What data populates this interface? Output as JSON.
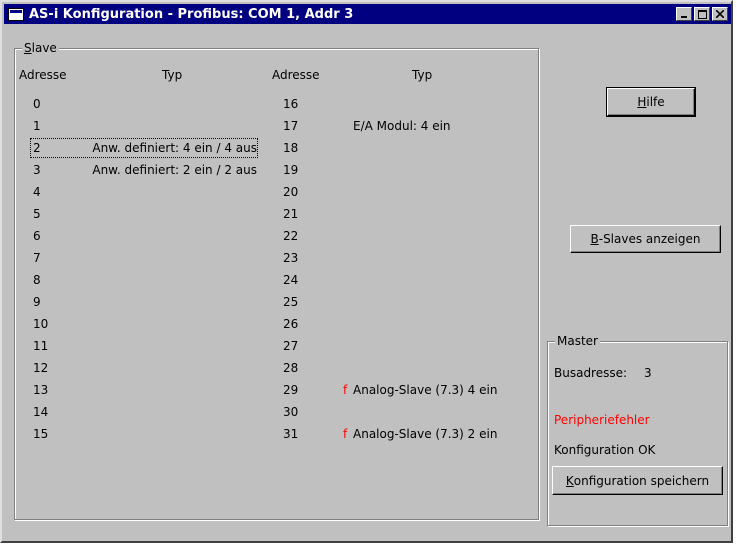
{
  "window": {
    "title": "AS-i Konfiguration - Profibus: COM 1, Addr 3",
    "icon": "window-app-icon",
    "controls": [
      "minimize",
      "maximize",
      "close"
    ]
  },
  "slave_group": {
    "label": "Slave",
    "label_accel": "S",
    "label_rest": "lave",
    "headers": {
      "adresse_left": "Adresse",
      "typ_left": "Typ",
      "adresse_right": "Adresse",
      "typ_right": "Typ"
    },
    "rows_left": [
      {
        "addr": "0",
        "typ": "",
        "flag": ""
      },
      {
        "addr": "1",
        "typ": "",
        "flag": ""
      },
      {
        "addr": "2",
        "typ": "Anw. definiert: 4 ein / 4 aus",
        "flag": ""
      },
      {
        "addr": "3",
        "typ": "Anw. definiert: 2 ein / 2 aus",
        "flag": ""
      },
      {
        "addr": "4",
        "typ": "",
        "flag": ""
      },
      {
        "addr": "5",
        "typ": "",
        "flag": ""
      },
      {
        "addr": "6",
        "typ": "",
        "flag": ""
      },
      {
        "addr": "7",
        "typ": "",
        "flag": ""
      },
      {
        "addr": "8",
        "typ": "",
        "flag": ""
      },
      {
        "addr": "9",
        "typ": "",
        "flag": ""
      },
      {
        "addr": "10",
        "typ": "",
        "flag": ""
      },
      {
        "addr": "11",
        "typ": "",
        "flag": ""
      },
      {
        "addr": "12",
        "typ": "",
        "flag": ""
      },
      {
        "addr": "13",
        "typ": "",
        "flag": ""
      },
      {
        "addr": "14",
        "typ": "",
        "flag": ""
      },
      {
        "addr": "15",
        "typ": "",
        "flag": ""
      }
    ],
    "rows_right": [
      {
        "addr": "16",
        "typ": "",
        "flag": ""
      },
      {
        "addr": "17",
        "typ": "E/A Modul: 4 ein",
        "flag": ""
      },
      {
        "addr": "18",
        "typ": "",
        "flag": ""
      },
      {
        "addr": "19",
        "typ": "",
        "flag": ""
      },
      {
        "addr": "20",
        "typ": "",
        "flag": ""
      },
      {
        "addr": "21",
        "typ": "",
        "flag": ""
      },
      {
        "addr": "22",
        "typ": "",
        "flag": ""
      },
      {
        "addr": "23",
        "typ": "",
        "flag": ""
      },
      {
        "addr": "24",
        "typ": "",
        "flag": ""
      },
      {
        "addr": "25",
        "typ": "",
        "flag": ""
      },
      {
        "addr": "26",
        "typ": "",
        "flag": ""
      },
      {
        "addr": "27",
        "typ": "",
        "flag": ""
      },
      {
        "addr": "28",
        "typ": "",
        "flag": ""
      },
      {
        "addr": "29",
        "typ": "Analog-Slave (7.3) 4 ein",
        "flag": "f"
      },
      {
        "addr": "30",
        "typ": "",
        "flag": ""
      },
      {
        "addr": "31",
        "typ": "Analog-Slave (7.3) 2 ein",
        "flag": "f"
      }
    ],
    "focused_row": "2"
  },
  "buttons": {
    "hilfe": {
      "accel": "H",
      "rest": "ilfe"
    },
    "b_slaves": {
      "accel": "B",
      "rest": "-Slaves anzeigen"
    },
    "konfig_speichern": {
      "accel": "K",
      "rest": "onfiguration speichern"
    }
  },
  "master_group": {
    "label": "Master",
    "busadresse_label": "Busadresse:",
    "busadresse_value": "3",
    "peripheriefehler": "Peripheriefehler",
    "konfiguration_status": "Konfiguration OK"
  },
  "colors": {
    "titlebar": "#000080",
    "face": "#c0c0c0",
    "error_text": "#ff0000"
  }
}
